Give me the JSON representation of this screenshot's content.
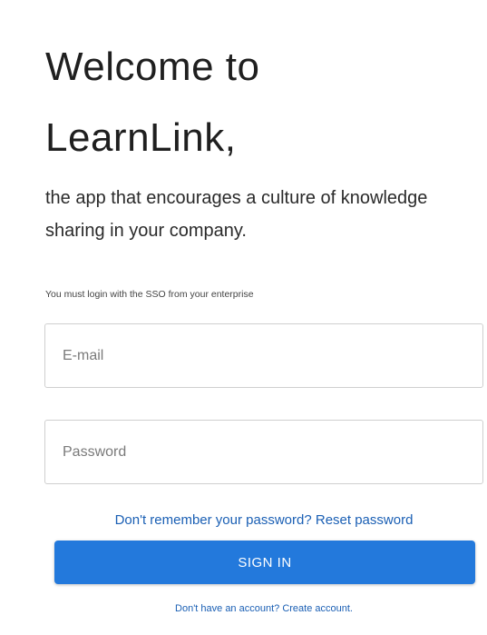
{
  "welcome": {
    "line1": "Welcome to",
    "line2": "LearnLink,"
  },
  "subtitle": "the app that encourages a culture of knowledge sharing in your company.",
  "sso_note": "You must login with the SSO from your enterprise",
  "form": {
    "email_placeholder": "E-mail",
    "password_placeholder": "Password",
    "email_value": "",
    "password_value": ""
  },
  "reset": {
    "prompt": "Don't remember your password? ",
    "link": "Reset password"
  },
  "signin_label": "SIGN IN",
  "create": {
    "prompt": "Don't have an account? ",
    "link": "Create account."
  },
  "colors": {
    "primary_button": "#2379dc",
    "link": "#1a5fb4",
    "field_border": "#cfcfcf"
  }
}
